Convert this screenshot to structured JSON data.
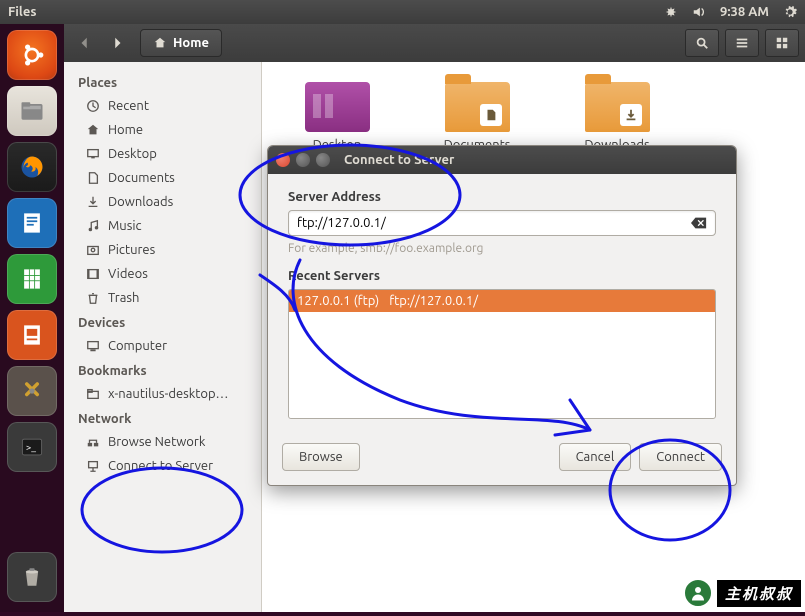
{
  "menubar": {
    "app": "Files",
    "time": "9:38 AM"
  },
  "toolbar": {
    "location": "Home"
  },
  "sidebar": {
    "places_heading": "Places",
    "places": [
      {
        "label": "Recent"
      },
      {
        "label": "Home"
      },
      {
        "label": "Desktop"
      },
      {
        "label": "Documents"
      },
      {
        "label": "Downloads"
      },
      {
        "label": "Music"
      },
      {
        "label": "Pictures"
      },
      {
        "label": "Videos"
      },
      {
        "label": "Trash"
      }
    ],
    "devices_heading": "Devices",
    "devices": [
      {
        "label": "Computer"
      }
    ],
    "bookmarks_heading": "Bookmarks",
    "bookmarks": [
      {
        "label": "x-nautilus-desktop…"
      }
    ],
    "network_heading": "Network",
    "network": [
      {
        "label": "Browse Network"
      },
      {
        "label": "Connect to Server"
      }
    ]
  },
  "content": {
    "folders": [
      {
        "label": "Desktop"
      },
      {
        "label": "Documents"
      },
      {
        "label": "Downloads"
      }
    ]
  },
  "dialog": {
    "title": "Connect to Server",
    "address_label": "Server Address",
    "address_value": "ftp://127.0.0.1/",
    "hint": "For example, smb://foo.example.org",
    "recent_label": "Recent Servers",
    "recent": {
      "name": "127.0.0.1 (ftp)",
      "uri": "ftp://127.0.0.1/"
    },
    "browse": "Browse",
    "cancel": "Cancel",
    "connect": "Connect"
  },
  "watermark": "主机叔叔"
}
